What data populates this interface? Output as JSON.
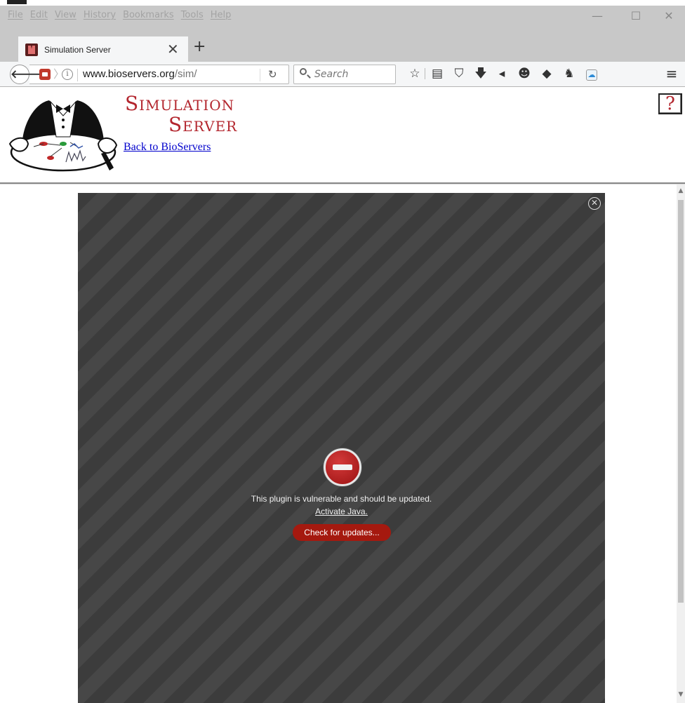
{
  "menubar": {
    "items": [
      "File",
      "Edit",
      "View",
      "History",
      "Bookmarks",
      "Tools",
      "Help"
    ]
  },
  "window_controls": {
    "minimize": "—",
    "maximize": "☐",
    "close": "✕"
  },
  "tab": {
    "title": "Simulation Server",
    "close": "✕",
    "new_tab": "+"
  },
  "navbar": {
    "url_domain": "www.bioservers.org",
    "url_path": "/sim/",
    "search_placeholder": "Search"
  },
  "toolbar_icons": [
    "bookmark-star-icon",
    "library-icon",
    "pocket-icon",
    "download-icon",
    "send-icon",
    "smiley-icon",
    "addon-icon",
    "puppet-icon",
    "cloud-icon",
    "hamburger-menu-icon"
  ],
  "page": {
    "title_line1": "Simulation",
    "title_line2": "Server",
    "back_link": "Back to BioServers",
    "help": "?"
  },
  "plugin": {
    "message": "This plugin is vulnerable and should be updated.",
    "activate": "Activate Java.",
    "update_button": "Check for updates...",
    "close": "✕"
  },
  "colors": {
    "accent_red": "#b3262e",
    "button_red": "#a5190f",
    "chrome_gray": "#c8c8c8",
    "plugin_bg": "#3c3c3c"
  }
}
